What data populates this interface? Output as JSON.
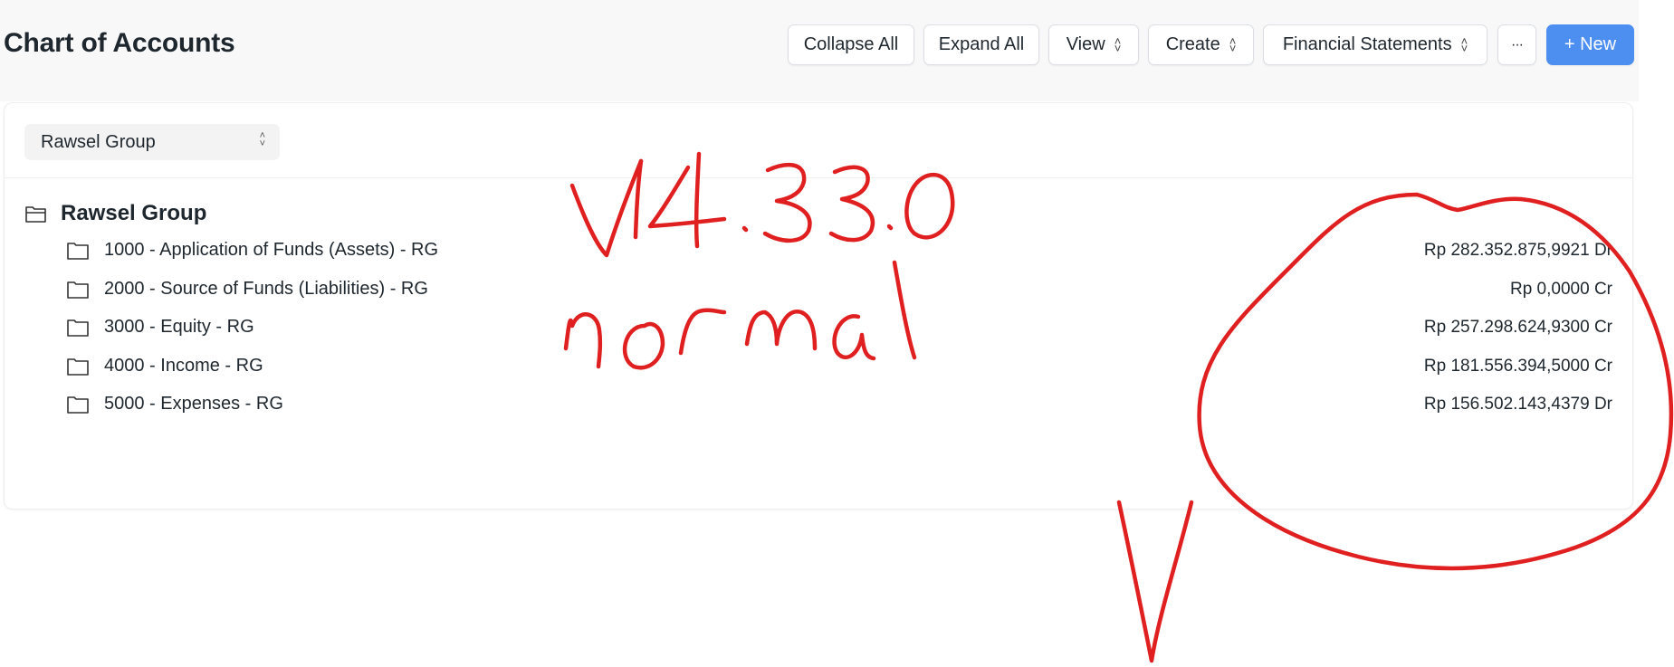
{
  "page": {
    "title": "Chart of Accounts"
  },
  "toolbar": {
    "collapse_all": "Collapse All",
    "expand_all": "Expand All",
    "view": "View",
    "create": "Create",
    "financial_statements": "Financial Statements",
    "more": "···",
    "new": "+ New"
  },
  "filter": {
    "company": "Rawsel Group"
  },
  "tree": {
    "root": "Rawsel Group",
    "accounts": [
      {
        "label": "1000 - Application of Funds (Assets) - RG",
        "balance": "Rp 282.352.875,9921 Dr"
      },
      {
        "label": "2000 - Source of Funds (Liabilities) - RG",
        "balance": "Rp 0,0000 Cr"
      },
      {
        "label": "3000 - Equity - RG",
        "balance": "Rp 257.298.624,9300 Cr"
      },
      {
        "label": "4000 - Income - RG",
        "balance": "Rp 181.556.394,5000 Cr"
      },
      {
        "label": "5000 - Expenses - RG",
        "balance": "Rp 156.502.143,4379 Dr"
      }
    ]
  },
  "annotation": {
    "version": "V14.33.0",
    "status": "normal",
    "color": "#e02020"
  },
  "colors": {
    "primary": "#4d8ff0",
    "annotation": "#e02020"
  }
}
